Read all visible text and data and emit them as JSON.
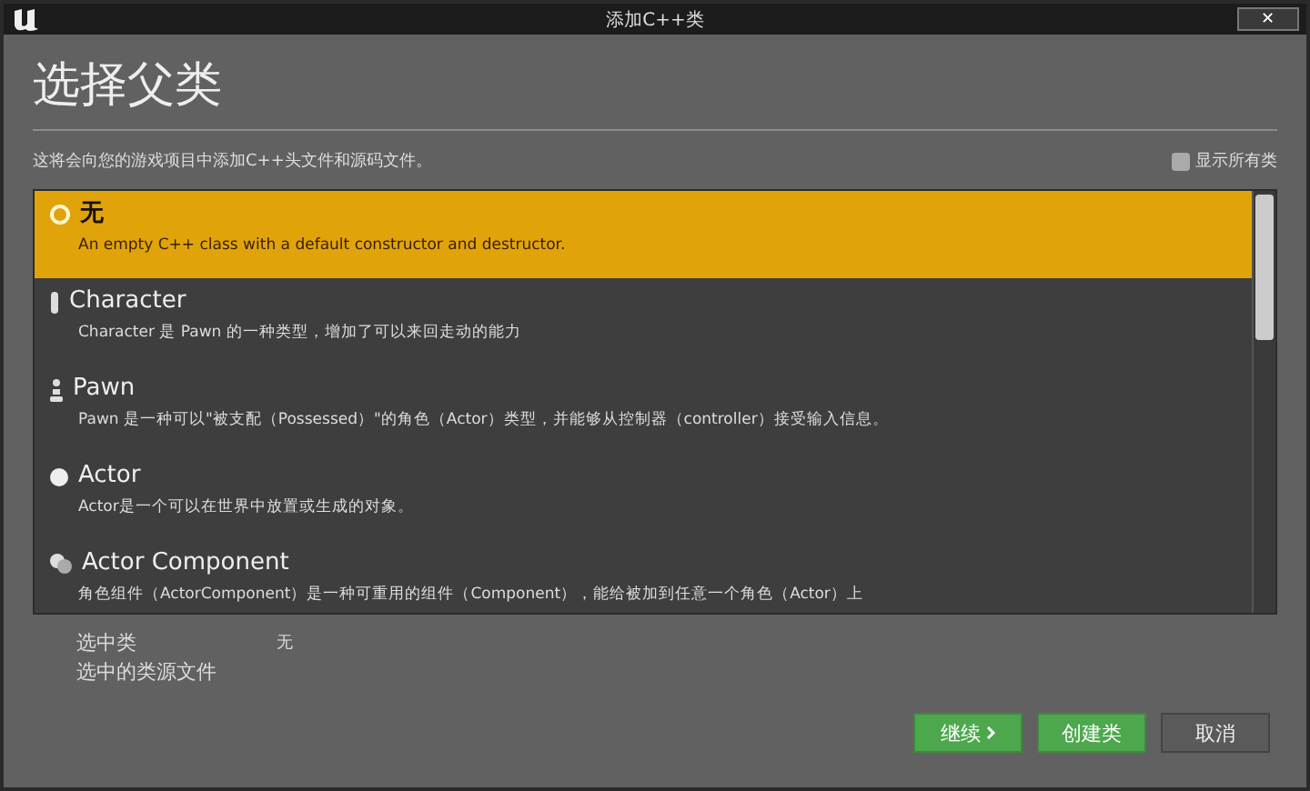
{
  "window": {
    "title": "添加C++类",
    "close": "✕"
  },
  "heading": "选择父类",
  "description": "这将会向您的游戏项目中添加C++头文件和源码文件。",
  "show_all": {
    "label": "显示所有类",
    "checked": false
  },
  "classes": [
    {
      "kind": "none",
      "name": "无",
      "summary": "An empty C++ class with a default constructor and destructor.",
      "selected": true
    },
    {
      "kind": "character",
      "name": "Character",
      "summary": "Character 是 Pawn 的一种类型，增加了可以来回走动的能力",
      "selected": false
    },
    {
      "kind": "pawn",
      "name": "Pawn",
      "summary": "Pawn 是一种可以\"被支配（Possessed）\"的角色（Actor）类型，并能够从控制器（controller）接受输入信息。",
      "selected": false
    },
    {
      "kind": "actor",
      "name": "Actor",
      "summary": "Actor是一个可以在世界中放置或生成的对象。",
      "selected": false
    },
    {
      "kind": "component",
      "name": "Actor Component",
      "summary": "角色组件（ActorComponent）是一种可重用的组件（Component），能给被加到任意一个角色（Actor）上",
      "selected": false
    }
  ],
  "selection": [
    {
      "label": "选中类",
      "value": "无"
    },
    {
      "label": "选中的类源文件"
    }
  ],
  "buttons": [
    {
      "label": "继续",
      "kind": "next"
    },
    {
      "label": "创建类",
      "kind": "primary"
    },
    {
      "label": "取消",
      "kind": "plain"
    }
  ]
}
